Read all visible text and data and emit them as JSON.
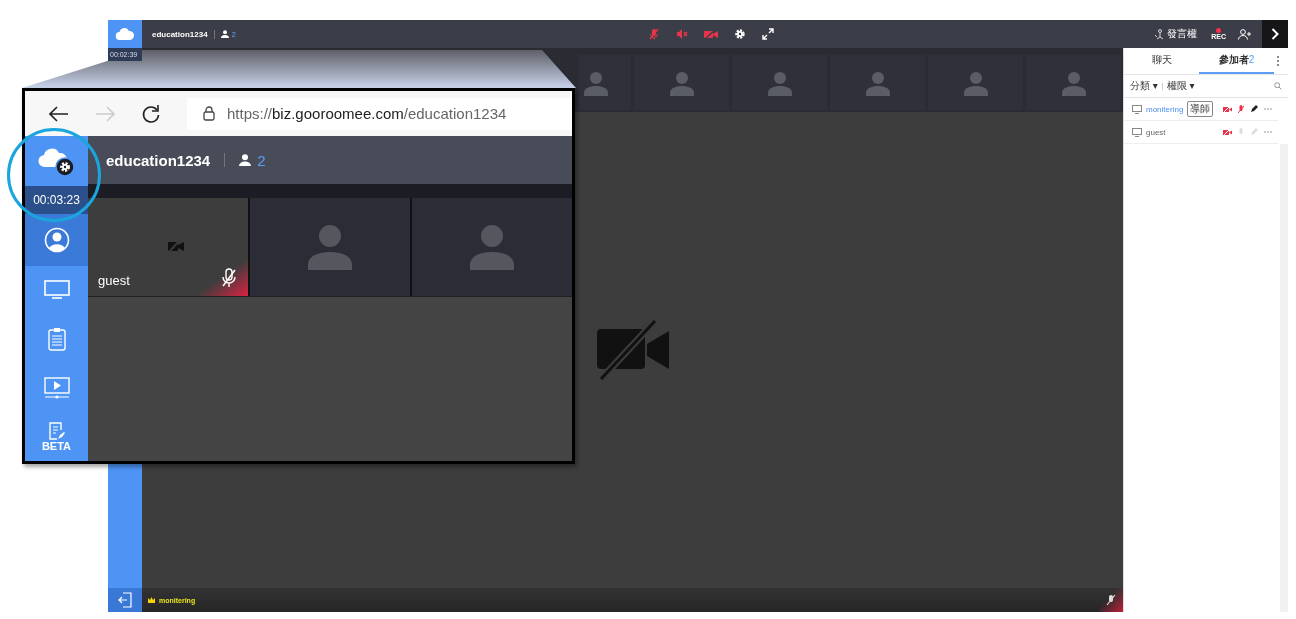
{
  "top_bar": {
    "room": "education1234",
    "participant_count": "2",
    "mic_muted": true,
    "speaker_muted": true,
    "camera_off": true,
    "floor_label": "發言權",
    "rec_label": "REC",
    "recording": true
  },
  "sidebar": {
    "timer": "00:02:39"
  },
  "main_video": {
    "name": "monitering",
    "camera_off": true,
    "mic_muted": true
  },
  "panel": {
    "tabs": [
      {
        "label": "聊天",
        "selected": false
      },
      {
        "label": "參加者",
        "count": "2",
        "selected": true
      }
    ],
    "filters": [
      "分類 ▾",
      "權限 ▾"
    ],
    "participants": [
      {
        "name": "monitering",
        "role": "導師",
        "is_me": true,
        "camera_off": true,
        "mic_muted": true,
        "pen": true
      },
      {
        "name": "guest",
        "is_me": false,
        "camera_off": true,
        "mic_muted": false,
        "pen": false
      }
    ]
  },
  "callout": {
    "url_scheme": "https://",
    "url_host": "biz.gooroomee.com",
    "url_path": "/education1234",
    "forward_enabled": false,
    "room": "education1234",
    "participant_count": "2",
    "timer": "00:03:23",
    "sidebar": [
      {
        "kind": "user",
        "selected": true
      },
      {
        "kind": "screen",
        "selected": false
      },
      {
        "kind": "board",
        "selected": false
      },
      {
        "kind": "video",
        "selected": false
      },
      {
        "kind": "note",
        "selected": false,
        "label": "BETA"
      }
    ],
    "tiles": [
      {
        "kind": "participant",
        "name": "guest",
        "camera_off": true,
        "mic_muted": true
      },
      {
        "kind": "empty"
      },
      {
        "kind": "empty"
      }
    ]
  }
}
